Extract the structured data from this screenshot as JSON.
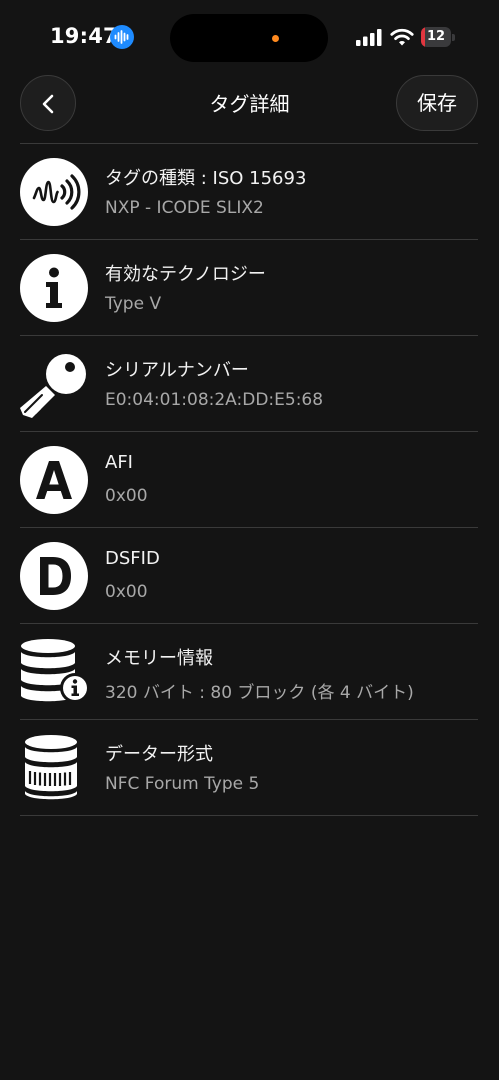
{
  "status_bar": {
    "time": "19:47",
    "battery": "12",
    "battery_level": 0.12,
    "icons": [
      "siri-waveform-icon",
      "cellular-signal-icon",
      "wifi-icon",
      "battery-icon"
    ]
  },
  "nav": {
    "back_icon": "chevron-left-icon",
    "title": "タグ詳細",
    "save_label": "保存"
  },
  "rows": [
    {
      "icon": "nfc-tag-icon",
      "title": "タグの種類 : ISO 15693",
      "value": "NXP - ICODE SLIX2"
    },
    {
      "icon": "info-icon",
      "title": "有効なテクノロジー",
      "value": "Type V"
    },
    {
      "icon": "key-icon",
      "title": "シリアルナンバー",
      "value": "E0:04:01:08:2A:DD:E5:68"
    },
    {
      "icon": "letter-a-icon",
      "title": "AFI",
      "value": "0x00"
    },
    {
      "icon": "letter-d-icon",
      "title": "DSFID",
      "value": "0x00"
    },
    {
      "icon": "database-info-icon",
      "title": "メモリー情報",
      "value": "320 バイト : 80 ブロック (各 4 バイト)"
    },
    {
      "icon": "storage-format-icon",
      "title": "データー形式",
      "value": "NFC Forum Type 5"
    }
  ],
  "colors": {
    "background": "#141414",
    "divider": "#3a3a3a",
    "secondary_text": "#a8a8a8",
    "battery_low": "#e0363f",
    "privacy_dot": "#ff8a1f",
    "siri_blue": "#1e8bff"
  }
}
